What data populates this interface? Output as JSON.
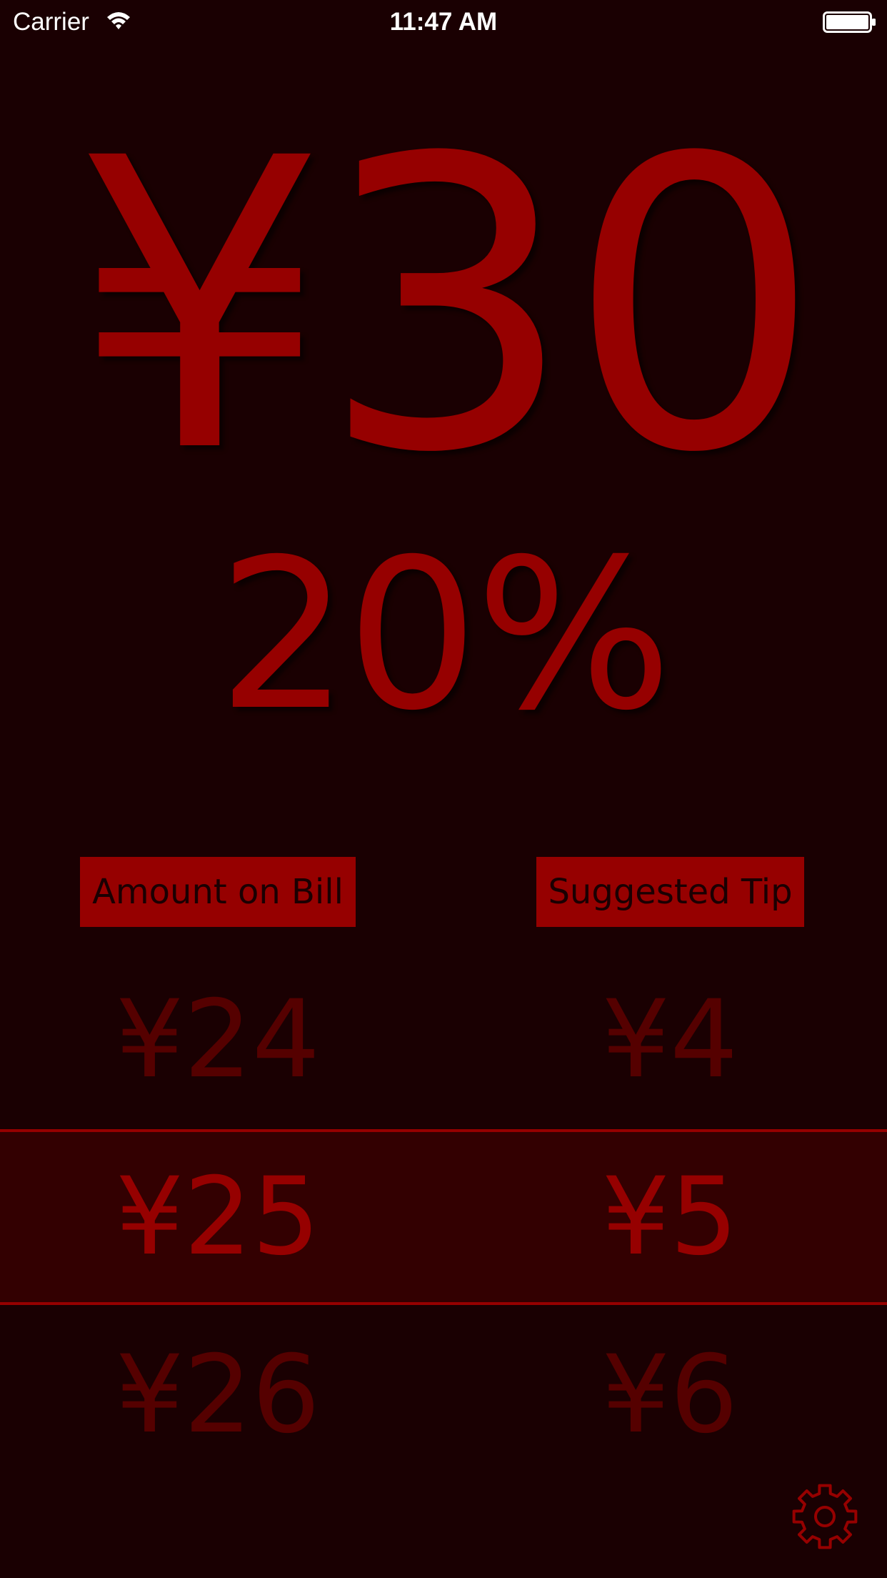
{
  "status_bar": {
    "carrier": "Carrier",
    "time": "11:47 AM",
    "icons": [
      "wifi-icon",
      "battery-icon"
    ]
  },
  "display": {
    "total": "¥30",
    "percent": "20%"
  },
  "labels": {
    "amount": "Amount on Bill",
    "tip": "Suggested Tip"
  },
  "picker": {
    "rows": [
      {
        "amount": "¥24",
        "tip": "¥4"
      },
      {
        "amount": "¥25",
        "tip": "¥5"
      },
      {
        "amount": "¥26",
        "tip": "¥6"
      }
    ],
    "selected": {
      "amount": "¥25",
      "tip": "¥5"
    }
  },
  "settings": {
    "icon": "gear-icon"
  },
  "colors": {
    "background": "#1a0002",
    "accent": "#960000",
    "dim": "#550000",
    "selected_band": "#330001"
  }
}
